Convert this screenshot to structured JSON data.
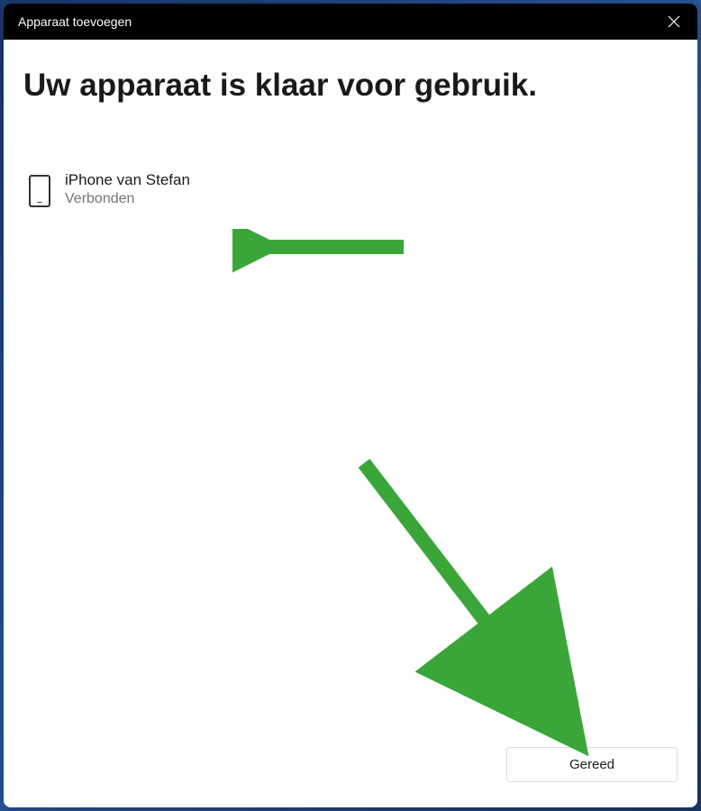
{
  "titlebar": {
    "title": "Apparaat toevoegen"
  },
  "main": {
    "heading": "Uw apparaat is klaar voor gebruik."
  },
  "device": {
    "name": "iPhone van Stefan",
    "status": "Verbonden"
  },
  "footer": {
    "done_label": "Gereed"
  },
  "annotations": {
    "arrow_color": "#3aa63a"
  }
}
